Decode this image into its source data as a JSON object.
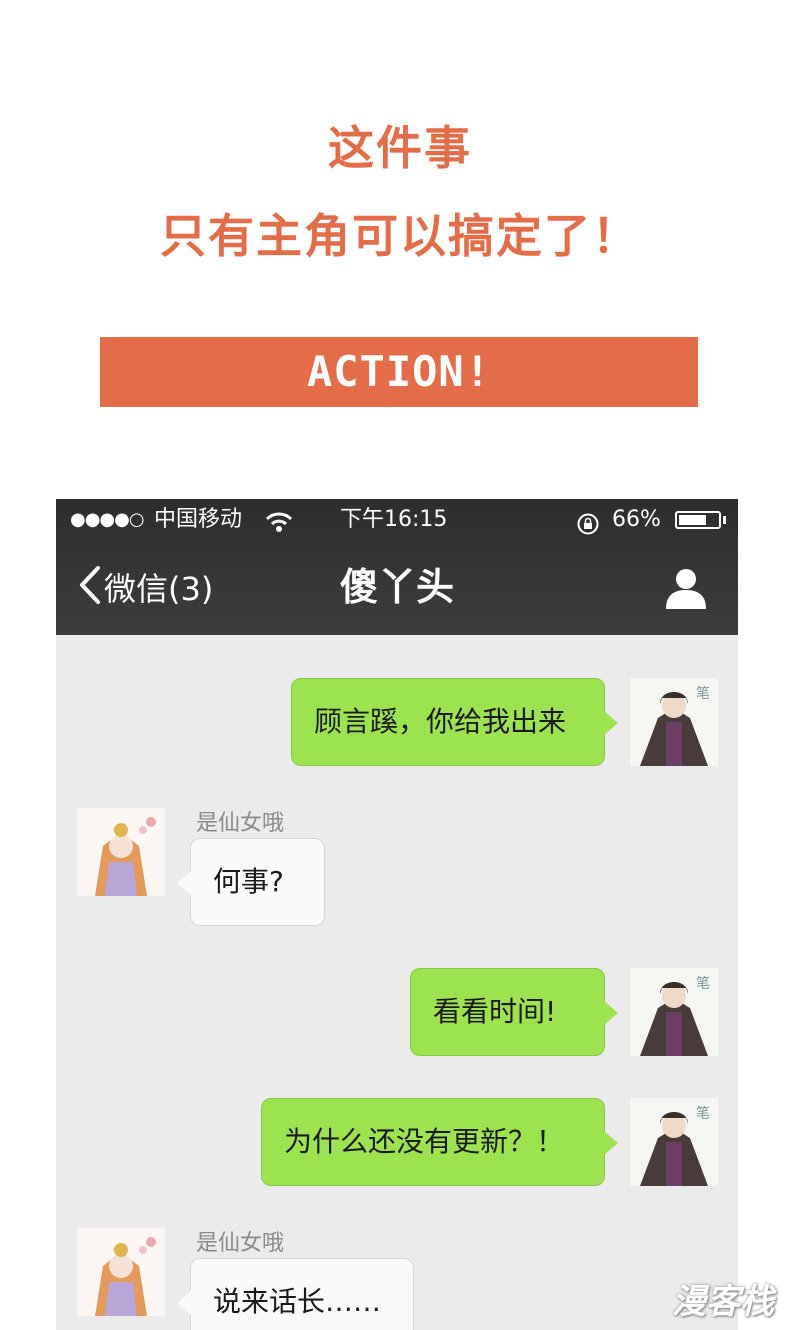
{
  "promo": {
    "line1": "这件事",
    "line2": "只有主角可以搞定了！",
    "banner": "ACTION!"
  },
  "status_bar": {
    "signal": "●●●●○",
    "carrier": "中国移动",
    "time": "下午16:15",
    "battery": "66%"
  },
  "nav": {
    "back_label": "微信(3)",
    "title": "傻丫头"
  },
  "messages": [
    {
      "side": "right",
      "text": "顾言蹊，你给我出来"
    },
    {
      "side": "left",
      "sender": "是仙女哦",
      "text": "何事?"
    },
    {
      "side": "right",
      "text": "看看时间!"
    },
    {
      "side": "right",
      "text": "为什么还没有更新？！"
    },
    {
      "side": "left",
      "sender": "是仙女哦",
      "text": "说来话长……"
    }
  ],
  "watermark": "漫客栈",
  "colors": {
    "accent": "#e46d49",
    "bubble_green": "#9de350",
    "chat_bg": "#ebebeb",
    "topbar": "#2d2d2f"
  }
}
